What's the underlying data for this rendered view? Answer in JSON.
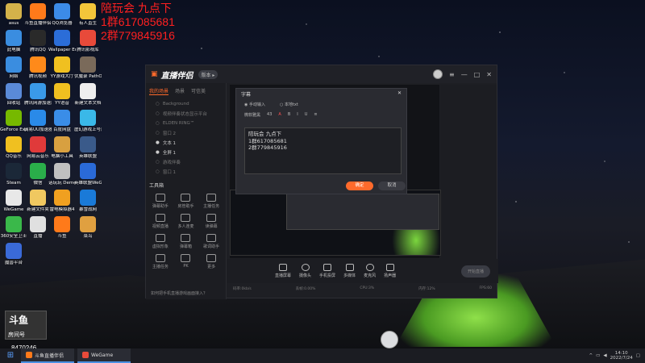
{
  "overlay": {
    "line1": "陪玩会 九点下",
    "line2": "1群617085681",
    "line3": "2群779845916"
  },
  "desktop_icons": [
    {
      "label": "asus",
      "color": "#d4b24a"
    },
    {
      "label": "斗鱼直播伴侣",
      "color": "#ff7a1a"
    },
    {
      "label": "QQ浏览器",
      "color": "#3c8be8"
    },
    {
      "label": "有人直生",
      "color": "#f3c63a"
    },
    {
      "label": "此电脑",
      "color": "#3a8de0"
    },
    {
      "label": "腾讯QQ",
      "color": "#2a2a2a"
    },
    {
      "label": "Wallpaper Engine",
      "color": "#2b6dd8"
    },
    {
      "label": "腾讯影视库",
      "color": "#e84a3a"
    },
    {
      "label": "网络",
      "color": "#3a8de0"
    },
    {
      "label": "腾讯视频",
      "color": "#ff8a1a"
    },
    {
      "label": "YY游戏大厅",
      "color": "#f0c020"
    },
    {
      "label": "伏魔录 PathOfW",
      "color": "#7a6a5a"
    },
    {
      "label": "回收站",
      "color": "#5a8ad8"
    },
    {
      "label": "腾讯网游加速器",
      "color": "#3a9ae8"
    },
    {
      "label": "YY语音",
      "color": "#f0c020"
    },
    {
      "label": "新建文本文档",
      "color": "#eeeeee"
    },
    {
      "label": "GeForce Experience",
      "color": "#76b900"
    },
    {
      "label": "网易UU加速器",
      "color": "#2a8ae8"
    },
    {
      "label": "百度网盘",
      "color": "#3a8de8"
    },
    {
      "label": "虚幻游戏上号器",
      "color": "#3ab8e8"
    },
    {
      "label": "QQ音乐",
      "color": "#f0c020"
    },
    {
      "label": "网易云音乐",
      "color": "#e03a3a"
    },
    {
      "label": "电脑小工具",
      "color": "#d8a040"
    },
    {
      "label": "英雄联盟",
      "color": "#3a5a8a"
    },
    {
      "label": "Steam",
      "color": "#1b2838"
    },
    {
      "label": "微信",
      "color": "#2aae4a"
    },
    {
      "label": "话玩玩 Demo",
      "color": "#c0c0c0"
    },
    {
      "label": "英雄联盟WeGame版",
      "color": "#2a6ad8"
    },
    {
      "label": "WeGame",
      "color": "#e8e8e8"
    },
    {
      "label": "新建文件夹",
      "color": "#f0c860"
    },
    {
      "label": "雷电模拟器4",
      "color": "#f0a020"
    },
    {
      "label": "暴雪战网",
      "color": "#1a7ad8"
    },
    {
      "label": "360安全卫士",
      "color": "#3ab84a"
    },
    {
      "label": "直播",
      "color": "#e0e0e0"
    },
    {
      "label": "斗鱼",
      "color": "#ff7a1a"
    },
    {
      "label": "菜鸟",
      "color": "#e0a040"
    },
    {
      "label": "魔兽平台",
      "color": "#3a6ad8"
    }
  ],
  "app": {
    "title": "直播伴侣",
    "version_badge": "版本 ▸",
    "left_tabs": [
      "我的场景",
      "场景",
      "可信美"
    ],
    "scenes": [
      {
        "label": "Background",
        "on": false
      },
      {
        "label": "视频伴奏状态显示平台",
        "on": false
      },
      {
        "label": "ELDEN RING™",
        "on": false
      },
      {
        "label": "窗口 2",
        "on": false
      },
      {
        "label": "文本 1",
        "on": true
      },
      {
        "label": "全屏 1",
        "on": true
      },
      {
        "label": "游戏伴奏",
        "on": false
      },
      {
        "label": "窗口 1",
        "on": false
      }
    ],
    "tools_header": "工具箱",
    "tools": [
      "弹幕助手",
      "房管助手",
      "主播任务",
      "视频直播",
      "多人连麦",
      "读弹幕",
      "虚拟形象",
      "弹幕箱",
      "歌词助手",
      "主播任务",
      "PK",
      "更多"
    ],
    "tip": "如何把手机直播游戏画面接入？",
    "bottom_buttons": [
      "直播屏幕",
      "摄像头",
      "手机投屏",
      "多媒体",
      "麦克风",
      "扬声器"
    ],
    "start_live": "开始直播",
    "status": [
      "码率:0kb/s",
      "丢帧:0.00%",
      "CPU:3%",
      "内存:12%",
      "FPS:60"
    ]
  },
  "dialog": {
    "title": "字幕",
    "radio1": "手动输入",
    "radio2": "本地txt",
    "font": "微软雅黑",
    "size": "43",
    "text": "陪玩会 九点下\n1群617085681\n2群779845916",
    "ok": "确定",
    "cancel": "取消"
  },
  "stream_logo": {
    "top": "斗鱼",
    "bottom": "房间号"
  },
  "room_number": "8470246",
  "taskbar": {
    "apps": [
      {
        "label": "斗鱼直播伴侣",
        "color": "#ff7a1a"
      },
      {
        "label": "WeGame",
        "color": "#e84a3a"
      }
    ],
    "time": "14:10",
    "date": "2022/7/24"
  }
}
